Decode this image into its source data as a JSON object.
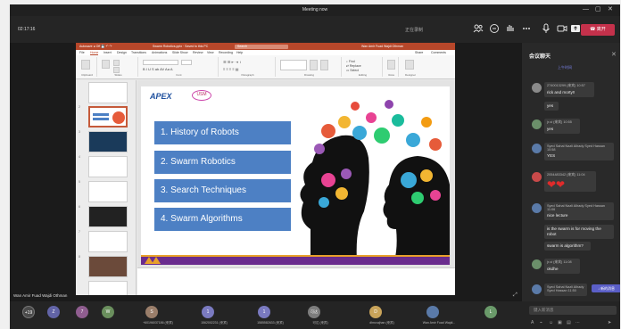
{
  "window": {
    "title": "Meeting now",
    "controls": [
      "—",
      "▢",
      "✕"
    ]
  },
  "meeting": {
    "timer": "02:17:16",
    "recording_text": "正在录制",
    "leave_label": "离开",
    "toolbar_icons": [
      "people-icon",
      "chat-icon",
      "reactions-icon",
      "more-icon",
      "mic-icon",
      "camera-icon",
      "share-icon"
    ]
  },
  "presentation": {
    "app_title_left": "Autosave  ● Off  💾 ↶ ↷",
    "app_title_mid": "Swarm Robotics.pptx  ·  Saved to this PC",
    "app_title_search": "Search",
    "app_title_user": "Wan Amir Fuad Wajdi Othman",
    "tabs": [
      "File",
      "Home",
      "Insert",
      "Design",
      "Transitions",
      "Animations",
      "Slide Show",
      "Review",
      "View",
      "Recording",
      "Help"
    ],
    "share_label": "Share",
    "comments_label": "Comments",
    "ribbon_groups": [
      "Clipboard",
      "Slides",
      "Font",
      "Paragraph",
      "Drawing",
      "Editing",
      "Voice",
      "Designer"
    ],
    "slide_logo": "APEX",
    "slide_logo2": "USM",
    "topics": [
      "1. History of Robots",
      "2. Swarm Robotics",
      "3. Search Techniques",
      "4. Swarm Algorithms"
    ],
    "thumb_numbers": [
      "1",
      "2",
      "3",
      "4",
      "5",
      "6",
      "7",
      "8"
    ],
    "presenter_name": "Wan Amir Fuad Wajdi Othman"
  },
  "chat": {
    "title": "会议聊天",
    "today_label": "上午时间",
    "new_messages_label": "新的消息",
    "messages": [
      {
        "sender": "2740013299 (来宾)",
        "time": "10:57",
        "lines": [
          "rick and morty!!"
        ]
      },
      {
        "sender": "",
        "time": "",
        "lines": [
          "yes"
        ]
      },
      {
        "sender": "jr-vi (来宾)",
        "time": "10:55",
        "lines": [
          "yes"
        ]
      },
      {
        "sender": "Syed Sahal Nazli Alhady Syed Hassan",
        "time": "10:58",
        "lines": [
          "YES"
        ]
      },
      {
        "sender": "2054483342 (来宾)",
        "time": "11:04",
        "lines": [
          "❤❤"
        ]
      },
      {
        "sender": "Syed Sahal Nazli Alhady Syed Hassan",
        "time": "11:06",
        "lines": [
          "nice lecture",
          "is the swarm is for moving the robot",
          "swarm is algorithm?"
        ]
      },
      {
        "sender": "jr-vi (来宾)",
        "time": "11:08",
        "lines": [
          "okdhe"
        ]
      },
      {
        "sender": "Syed Sahal Nazli Alhady Syed Hassan",
        "time": "11:50",
        "lines": [
          ""
        ]
      }
    ],
    "compose_placeholder": "键入新消息",
    "compose_icons": [
      "format-icon",
      "attach-icon",
      "emoji-icon",
      "gif-icon",
      "sticker-icon",
      "more-icon",
      "send-icon"
    ]
  },
  "participants": [
    {
      "initials": "+19",
      "name": "",
      "color": "#4a4a4a"
    },
    {
      "initials": "Z",
      "name": "",
      "color": "#6264a7"
    },
    {
      "initials": "7",
      "name": "",
      "color": "#8f5d8f"
    },
    {
      "initials": "W",
      "name": "",
      "color": "#6a8f5d"
    },
    {
      "initials": "S",
      "name": "+60196037186 (来宾)",
      "color": "#9a7e6a"
    },
    {
      "initials": "1",
      "name": "1562002231 (来宾)",
      "color": "#7a7ac0"
    },
    {
      "initials": "1",
      "name": "1585582633 (来宾)",
      "color": "#7a7ac0"
    },
    {
      "initials": "可达",
      "name": "可达 (来宾)",
      "color": "#7d7d7d"
    },
    {
      "initials": "D",
      "name": "dhruvajhan (来宾)",
      "color": "#c9a45a"
    },
    {
      "initials": "",
      "name": "Wan Amir Fuad Wajdi...",
      "color": "#5a7aa8"
    },
    {
      "initials": "L",
      "name": "",
      "color": "#6a9a6a"
    }
  ]
}
